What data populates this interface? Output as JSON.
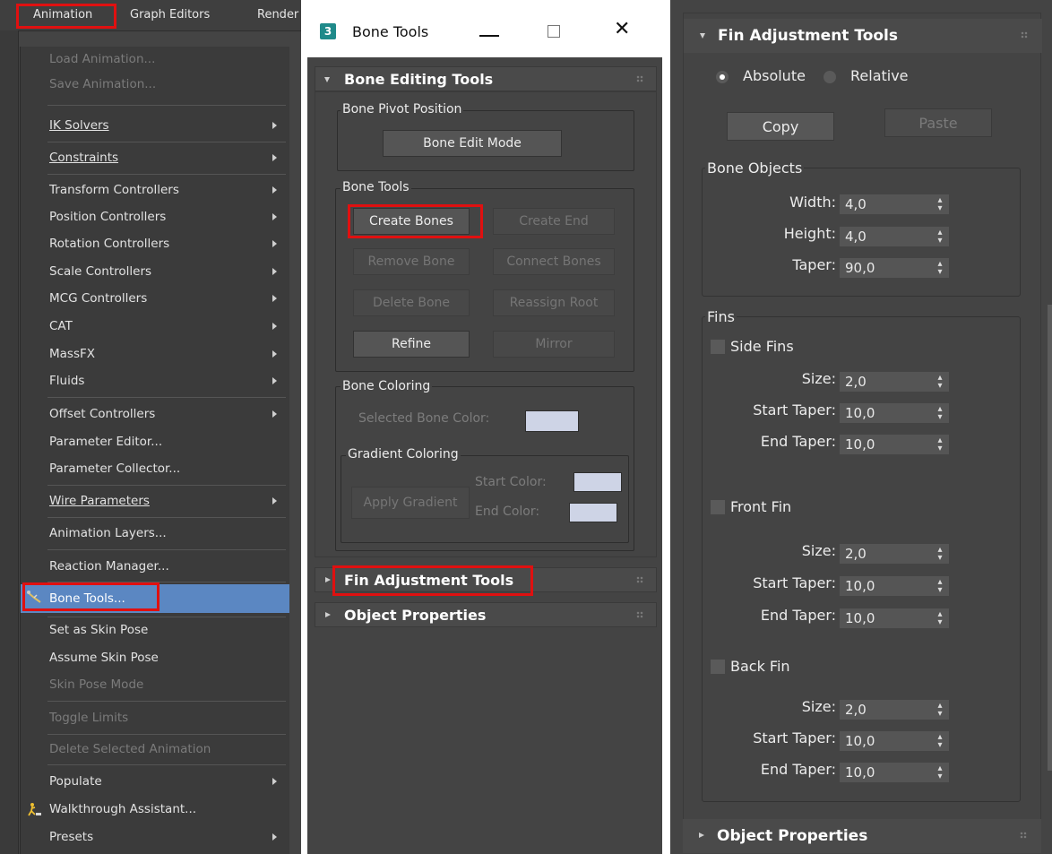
{
  "menubar": {
    "items": [
      "Animation",
      "Graph Editors",
      "Render"
    ]
  },
  "anim_menu": {
    "items": [
      {
        "label": "Load Animation...",
        "disabled": true
      },
      {
        "label": "Save Animation...",
        "disabled": true
      },
      {
        "label": "IK Solvers",
        "submenu": true
      },
      {
        "label": "Constraints",
        "submenu": true
      },
      {
        "label": "Transform Controllers",
        "submenu": true
      },
      {
        "label": "Position Controllers",
        "submenu": true
      },
      {
        "label": "Rotation Controllers",
        "submenu": true
      },
      {
        "label": "Scale Controllers",
        "submenu": true
      },
      {
        "label": "MCG Controllers",
        "submenu": true
      },
      {
        "label": "CAT",
        "submenu": true
      },
      {
        "label": "MassFX",
        "submenu": true
      },
      {
        "label": "Fluids",
        "submenu": true
      },
      {
        "label": "Offset Controllers",
        "submenu": true
      },
      {
        "label": "Parameter Editor..."
      },
      {
        "label": "Parameter Collector..."
      },
      {
        "label": "Wire Parameters",
        "submenu": true
      },
      {
        "label": "Animation Layers..."
      },
      {
        "label": "Reaction Manager..."
      },
      {
        "label": "Bone Tools...",
        "selected": true,
        "icon": "bone-tools-icon"
      },
      {
        "label": "Set as Skin Pose"
      },
      {
        "label": "Assume Skin Pose"
      },
      {
        "label": "Skin Pose Mode",
        "disabled": true
      },
      {
        "label": "Toggle Limits",
        "disabled": true
      },
      {
        "label": "Delete Selected Animation",
        "disabled": true
      },
      {
        "label": "Populate",
        "submenu": true
      },
      {
        "label": "Walkthrough Assistant...",
        "icon": "walkthrough-icon"
      },
      {
        "label": "Presets",
        "submenu": true
      }
    ]
  },
  "bone_tools_window": {
    "title": "Bone Tools",
    "editing_rollout": {
      "title": "Bone Editing Tools",
      "pivot_group": {
        "label": "Bone Pivot Position",
        "button": "Bone Edit Mode"
      },
      "tools_group": {
        "label": "Bone Tools",
        "create_bones": "Create Bones",
        "create_end": "Create End",
        "remove_bone": "Remove Bone",
        "connect_bones": "Connect Bones",
        "delete_bone": "Delete Bone",
        "reassign_root": "Reassign Root",
        "refine": "Refine",
        "mirror": "Mirror"
      },
      "coloring_group": {
        "label": "Bone Coloring",
        "selected_color_label": "Selected Bone Color:",
        "gradient_group": {
          "label": "Gradient Coloring",
          "apply_button": "Apply Gradient",
          "start_color_label": "Start Color:",
          "end_color_label": "End Color:"
        }
      }
    },
    "fin_rollout": {
      "title": "Fin Adjustment Tools"
    },
    "object_rollout": {
      "title": "Object Properties"
    }
  },
  "fin_panel": {
    "title": "Fin Adjustment Tools",
    "mode": {
      "absolute": "Absolute",
      "relative": "Relative",
      "selected": "Absolute"
    },
    "copy": "Copy",
    "paste": "Paste",
    "bone_objects": {
      "label": "Bone Objects",
      "width_label": "Width:",
      "width": "4,0",
      "height_label": "Height:",
      "height": "4,0",
      "taper_label": "Taper:",
      "taper": "90,0"
    },
    "fins": {
      "label": "Fins",
      "side": {
        "label": "Side Fins",
        "size_label": "Size:",
        "size": "2,0",
        "start_label": "Start Taper:",
        "start": "10,0",
        "end_label": "End Taper:",
        "end": "10,0"
      },
      "front": {
        "label": "Front Fin",
        "size_label": "Size:",
        "size": "2,0",
        "start_label": "Start Taper:",
        "start": "10,0",
        "end_label": "End Taper:",
        "end": "10,0"
      },
      "back": {
        "label": "Back Fin",
        "size_label": "Size:",
        "size": "2,0",
        "start_label": "Start Taper:",
        "start": "10,0",
        "end_label": "End Taper:",
        "end": "10,0"
      }
    },
    "object_properties": "Object Properties"
  },
  "colors": {
    "highlight_box": "#e01010",
    "menu_selected": "#5b87c2",
    "bone_color_swatch": "#ced4e6"
  }
}
